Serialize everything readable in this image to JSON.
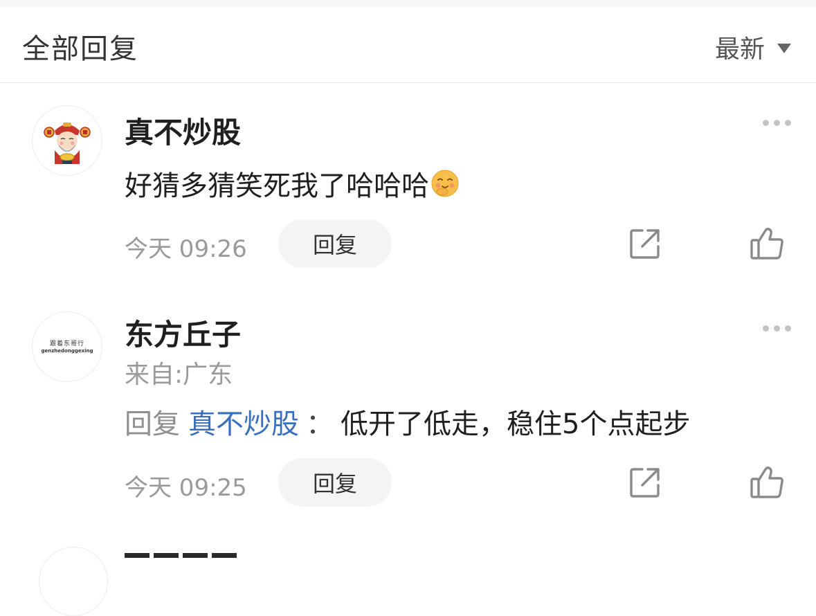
{
  "header": {
    "title": "全部回复",
    "sort_label": "最新"
  },
  "comments": [
    {
      "username": "真不炒股",
      "text": "好猜多猜笑死我了哈哈哈",
      "emoji": "smiling-blushing-emoji",
      "time": "今天 09:26",
      "reply_label": "回复"
    },
    {
      "username": "东方丘子",
      "location": "来自:广东",
      "reply_prefix": "回复",
      "reply_to": "真不炒股",
      "colon": "：",
      "text": "低开了低走，稳住5个点起步",
      "time": "今天 09:25",
      "reply_label": "回复",
      "avatar_text_cn": "跟着东哥行",
      "avatar_text_en": "genzhedonggexing"
    }
  ],
  "colors": {
    "link_blue": "#3a6fc0",
    "secondary_gray": "#9a9a9a",
    "button_bg": "#f3f4f6"
  }
}
